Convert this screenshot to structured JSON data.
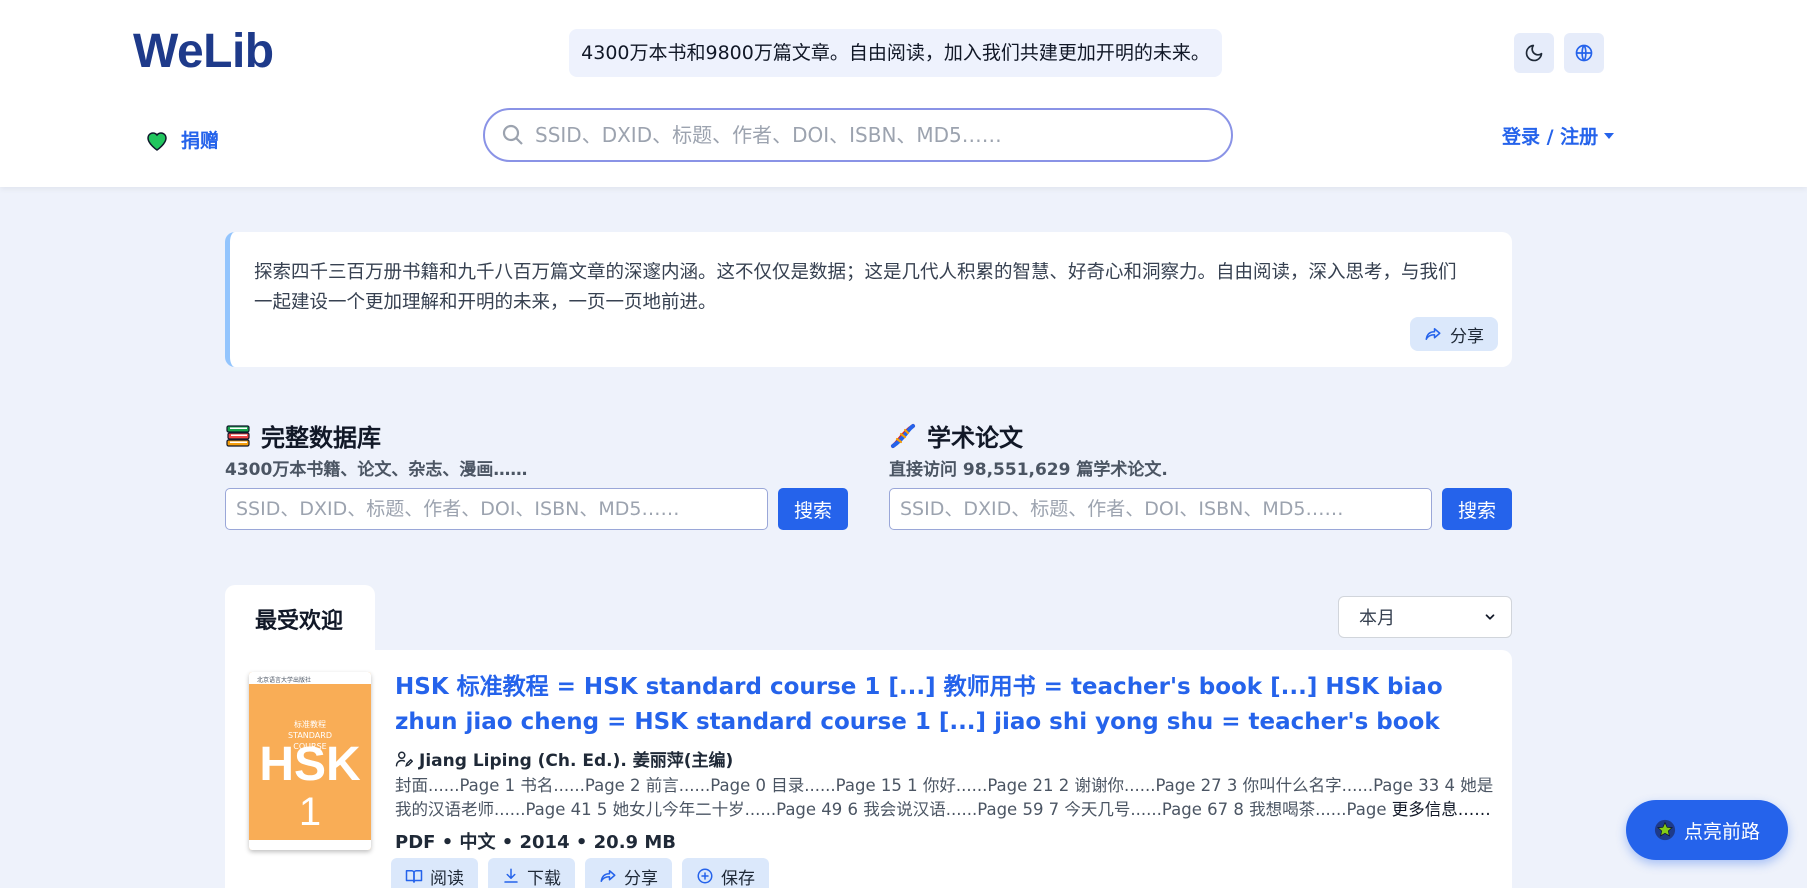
{
  "header": {
    "logo": "WeLib",
    "tagline": "4300万本书和9800万篇文章。自由阅读，加入我们共建更加开明的未来。",
    "donate_label": "捐赠",
    "search_placeholder": "SSID、DXID、标题、作者、DOI、ISBN、MD5……",
    "login_label": "登录 / 注册"
  },
  "intro": {
    "text": "探索四千三百万册书籍和九千八百万篇文章的深邃内涵。这不仅仅是数据；这是几代人积累的智慧、好奇心和洞察力。自由阅读，深入思考，与我们一起建设一个更加理解和开明的未来，一页一页地前进。",
    "share_label": "分享"
  },
  "databases": [
    {
      "title": "完整数据库",
      "subtitle": "4300万本书籍、论文、杂志、漫画……",
      "placeholder": "SSID、DXID、标题、作者、DOI、ISBN、MD5……",
      "button": "搜索"
    },
    {
      "title": "学术论文",
      "subtitle": "直接访问 98,551,629 篇学术论文.",
      "placeholder": "SSID、DXID、标题、作者、DOI、ISBN、MD5……",
      "button": "搜索"
    }
  ],
  "popular": {
    "tab_label": "最受欢迎",
    "period": "本月",
    "book": {
      "cover": {
        "publisher": "北京语言大学出版社",
        "series": "标准教程\nSTANDARD\nCOURSE",
        "brand": "HSK",
        "level": "1"
      },
      "title": "HSK 标准教程 = HSK standard course 1 [...] 教师用书 = teacher's book [...] HSK biao zhun jiao cheng = HSK standard course 1 [...] jiao shi yong shu = teacher's book",
      "author": "Jiang Liping (Ch. Ed.). 姜丽萍(主编)",
      "description": "封面......Page 1 书名......Page 2 前言......Page 0 目录......Page 15 1 你好......Page 21 2 谢谢你......Page 27 3 你叫什么名字......Page 33 4 她是我的汉语老师......Page 41 5 她女儿今年二十岁......Page 49 6 我会说汉语......Page 59 7 今天几号......Page 67 8 我想喝茶......Page",
      "more_label": "更多信息……",
      "meta": "PDF • 中文 • 2014 • 20.9 MB",
      "actions": [
        "阅读",
        "下载",
        "分享",
        "保存"
      ]
    }
  },
  "floating_button": "点亮前路",
  "colors": {
    "brand": "#1e3a8a",
    "accent": "#2563eb",
    "background": "#eef2fb",
    "heart": "#22c55e"
  }
}
